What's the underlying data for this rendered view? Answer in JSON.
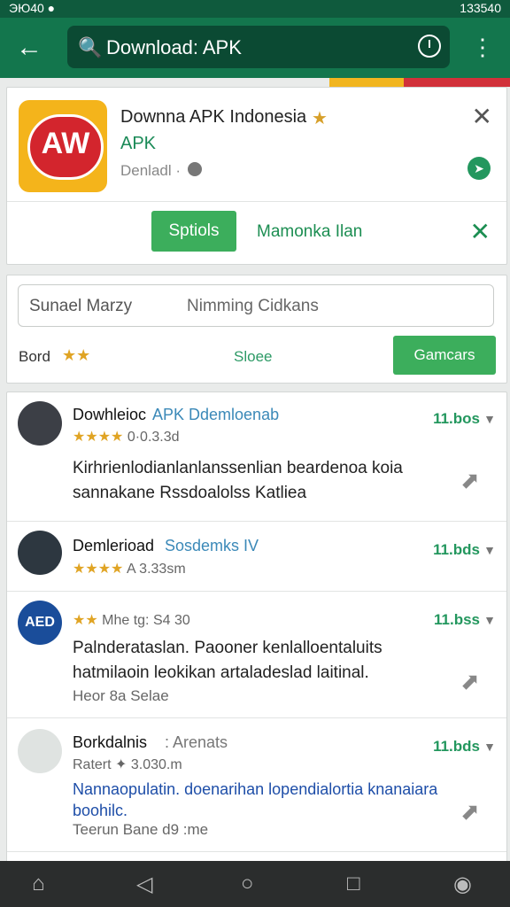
{
  "status": {
    "left": "ЭЮ40 ●",
    "right": "133540"
  },
  "appbar": {
    "back_glyph": "←",
    "search_text": "Download: APK",
    "more_glyph": "⋮"
  },
  "app": {
    "title": "Downna APK Indonesia",
    "subtitle": "APK",
    "developer": "Denladl ·",
    "logo_text": "AW",
    "primary_button": "Sptiols",
    "secondary_link": "Mamonka Ilan"
  },
  "filter": {
    "field_left": "Sunael Marzy",
    "field_right": "Nimming Cidkans",
    "rating_label": "Bord",
    "stars": "★★",
    "middle_text": "Sloee",
    "button": "Gamcars"
  },
  "rows": [
    {
      "name": "Dowhleioc",
      "tag": "APK Ddemloenab",
      "stars": "★★★★",
      "meta": "0·0.3.3d",
      "size": "11.bos",
      "body": "Kirhrienlodianlanlanssenlian beardenoa koia sannakane Rssdoalolss Katliea"
    },
    {
      "name": "Demlerioad",
      "tag": "Sosdemks IV",
      "stars": "★★★★",
      "meta": "A 3.33sm",
      "size": "11.bds"
    },
    {
      "name": "",
      "tag": "",
      "stars": "★★",
      "meta": "Mhe tg: S4 30",
      "size": "11.bss",
      "avatar_text": "AED",
      "body": "Palnderataslan. Paooner kenlalloentaluits hatmilaoin leokikan artaladeslad laitinal.",
      "small": "Heor 8a Selae"
    },
    {
      "name": "Borkdalnis",
      "tag": ": Arenats",
      "stars": "",
      "meta": "Ratert ✦ 3.030.m",
      "size": "11.bds",
      "body": "Nannaopulatin. doenarihan lopendialortia knanaiara boohilc.",
      "small": "Teerun Bane d9 :me"
    }
  ]
}
